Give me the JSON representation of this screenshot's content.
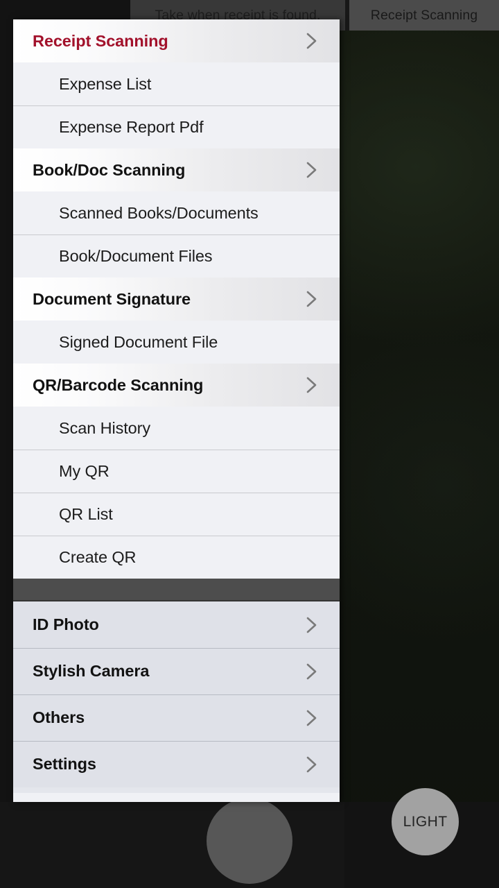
{
  "app": {
    "hint_text": "Take when receipt is found.",
    "mode_tab": "Receipt Scanning",
    "light_button": "LIGHT",
    "shutter_button": "shutter"
  },
  "colors": {
    "accent_red": "#a2112b",
    "header_gradient_start": "#ffffff",
    "header_gradient_end": "#e2e2e5",
    "item_background": "#f0f1f5",
    "bottom_background": "#dfe1e8",
    "strip_gray": "#4d4d4d",
    "light_button": "#a2a2a2",
    "shutter_button": "#575757"
  },
  "drawer": {
    "groups": [
      {
        "header": "Receipt Scanning",
        "active": true,
        "chevron": "chevron-right-icon",
        "items": [
          {
            "label": "Expense List"
          },
          {
            "label": "Expense Report Pdf"
          }
        ]
      },
      {
        "header": "Book/Doc Scanning",
        "active": false,
        "chevron": "chevron-right-icon",
        "items": [
          {
            "label": "Scanned Books/Documents"
          },
          {
            "label": "Book/Document Files"
          }
        ]
      },
      {
        "header": "Document Signature",
        "active": false,
        "chevron": "chevron-right-icon",
        "items": [
          {
            "label": "Signed Document File"
          }
        ]
      },
      {
        "header": "QR/Barcode Scanning",
        "active": false,
        "chevron": "chevron-right-icon",
        "items": [
          {
            "label": "Scan History"
          },
          {
            "label": "My QR"
          },
          {
            "label": "QR List"
          },
          {
            "label": "Create QR"
          }
        ]
      }
    ],
    "bottom_entries": [
      {
        "label": "ID Photo",
        "chevron": "chevron-right-icon"
      },
      {
        "label": "Stylish Camera",
        "chevron": "chevron-right-icon"
      },
      {
        "label": "Others",
        "chevron": "chevron-right-icon"
      },
      {
        "label": "Settings",
        "chevron": "chevron-right-icon"
      }
    ]
  }
}
